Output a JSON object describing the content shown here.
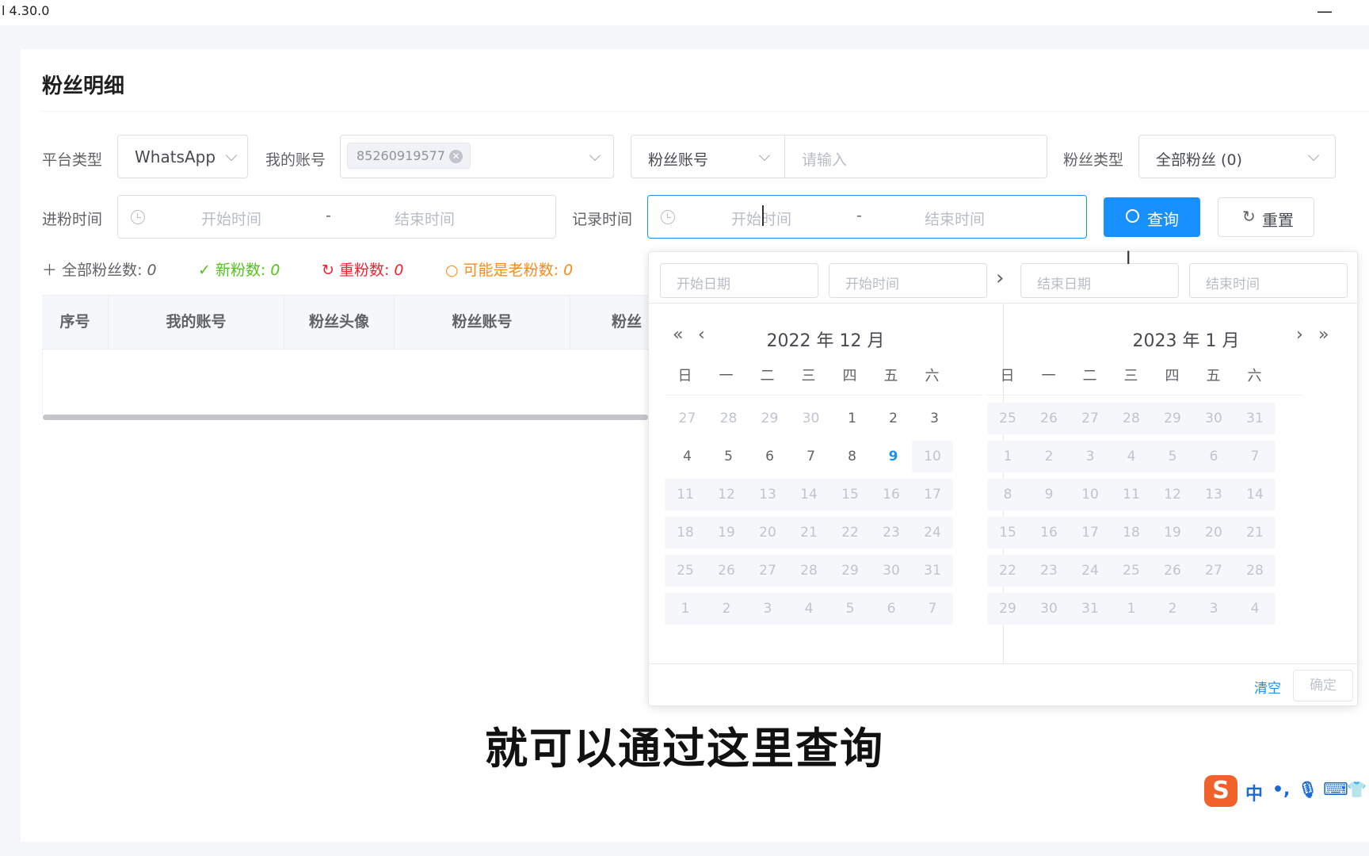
{
  "titlebar": {
    "version": "l 4.30.0",
    "minimize": "—"
  },
  "page": {
    "title": "粉丝明细"
  },
  "filters": {
    "platform_label": "平台类型",
    "platform_value": "WhatsApp",
    "my_account_label": "我的账号",
    "my_account_tag": "85260919577",
    "fan_account_select": "粉丝账号",
    "fan_account_placeholder": "请输入",
    "fan_type_label": "粉丝类型",
    "fan_type_value": "全部粉丝 (0)",
    "join_time_label": "进粉时间",
    "join_start_placeholder": "开始时间",
    "join_end_placeholder": "结束时间",
    "record_time_label": "记录时间",
    "record_start_placeholder": "开始时间",
    "record_end_placeholder": "结束时间",
    "range_sep": "-",
    "query_button": "查询",
    "reset_button": "重置"
  },
  "stats": {
    "all_label": "全部粉丝数:",
    "all_value": "0",
    "new_label": "新粉数:",
    "new_value": "0",
    "dup_label": "重粉数:",
    "dup_value": "0",
    "old_label": "可能是老粉数:",
    "old_value": "0",
    "colors": {
      "all": "#606266",
      "new": "#52c41a",
      "dup": "#f5222d",
      "old": "#fa8c16"
    }
  },
  "table": {
    "headers": [
      "序号",
      "我的账号",
      "粉丝头像",
      "粉丝账号",
      "粉丝"
    ]
  },
  "picker": {
    "start_date_placeholder": "开始日期",
    "start_time_placeholder": "开始时间",
    "end_date_placeholder": "结束日期",
    "end_time_placeholder": "结束时间",
    "weekdays": [
      "日",
      "一",
      "二",
      "三",
      "四",
      "五",
      "六"
    ],
    "left": {
      "title": "2022 年 12 月",
      "weeks": [
        [
          "27",
          "28",
          "29",
          "30",
          "1",
          "2",
          "3"
        ],
        [
          "4",
          "5",
          "6",
          "7",
          "8",
          "9",
          "10"
        ],
        [
          "11",
          "12",
          "13",
          "14",
          "15",
          "16",
          "17"
        ],
        [
          "18",
          "19",
          "20",
          "21",
          "22",
          "23",
          "24"
        ],
        [
          "25",
          "26",
          "27",
          "28",
          "29",
          "30",
          "31"
        ],
        [
          "1",
          "2",
          "3",
          "4",
          "5",
          "6",
          "7"
        ]
      ]
    },
    "right": {
      "title": "2023 年 1 月",
      "weeks": [
        [
          "25",
          "26",
          "27",
          "28",
          "29",
          "30",
          "31"
        ],
        [
          "1",
          "2",
          "3",
          "4",
          "5",
          "6",
          "7"
        ],
        [
          "8",
          "9",
          "10",
          "11",
          "12",
          "13",
          "14"
        ],
        [
          "15",
          "16",
          "17",
          "18",
          "19",
          "20",
          "21"
        ],
        [
          "22",
          "23",
          "24",
          "25",
          "26",
          "27",
          "28"
        ],
        [
          "29",
          "30",
          "31",
          "1",
          "2",
          "3",
          "4"
        ]
      ]
    },
    "today": "9",
    "clear": "清空",
    "confirm": "确定",
    "accent": "#1890ff"
  },
  "subtitle": "就可以通过这里查询",
  "ime": {
    "logo": "S",
    "lang": "中",
    "punct": "•,",
    "mic": "🎙",
    "keyboard": "⌨",
    "skin": "👕"
  }
}
